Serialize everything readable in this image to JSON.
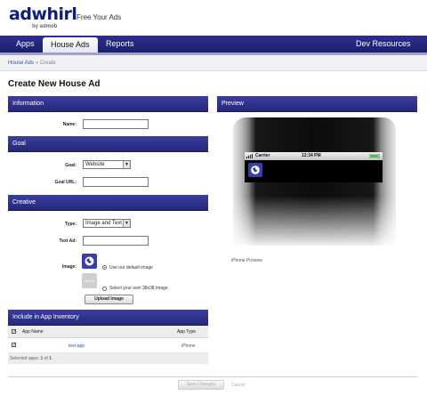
{
  "brand": {
    "logo": "adwhirl",
    "by": "by admob",
    "tagline": "Free Your Ads"
  },
  "nav": {
    "apps": "Apps",
    "house_ads": "House Ads",
    "reports": "Reports",
    "dev_resources": "Dev Resources"
  },
  "breadcrumb": {
    "parent": "House Ads",
    "sep": "»",
    "current": "Create"
  },
  "page": {
    "title": "Create New House Ad"
  },
  "information": {
    "heading": "Information",
    "name_label": "Name:",
    "name_value": ""
  },
  "goal": {
    "heading": "Goal",
    "goal_label": "Goal:",
    "goal_selected": "Website",
    "url_label": "Goal URL:",
    "url_value": ""
  },
  "creative": {
    "heading": "Creative",
    "type_label": "Type:",
    "type_selected": "Image and Text",
    "text_label": "Text Ad:",
    "text_value": "",
    "image_label": "Image:",
    "default_image_option": "Use our default image",
    "placeholder_text": "38x38",
    "own_image_option": "Select your own 38x38 image",
    "upload_label": "Upload Image"
  },
  "inventory": {
    "heading": "Include in App Inventory",
    "col_name": "App Name",
    "col_type": "App Type",
    "rows": [
      {
        "name": "test-app",
        "type": "iPhone"
      }
    ],
    "footer_prefix": "Selected apps:",
    "footer_count": "1",
    "footer_of": "of",
    "footer_total": "1"
  },
  "preview": {
    "heading": "Preview",
    "carrier": "Carrier",
    "time": "12:34 PM",
    "caption": "iPhone Preview"
  },
  "actions": {
    "save": "Save Changes",
    "cancel": "Cancel"
  },
  "colors": {
    "nav_bg": "#25287a",
    "section_bg": "#2f3290",
    "link": "#2f56a6",
    "icon_blue": "#3a3fa8"
  },
  "icons": {
    "globe": "globe-icon",
    "battery": "battery-icon",
    "signal": "signal-icon",
    "check": "checkmark-icon"
  }
}
